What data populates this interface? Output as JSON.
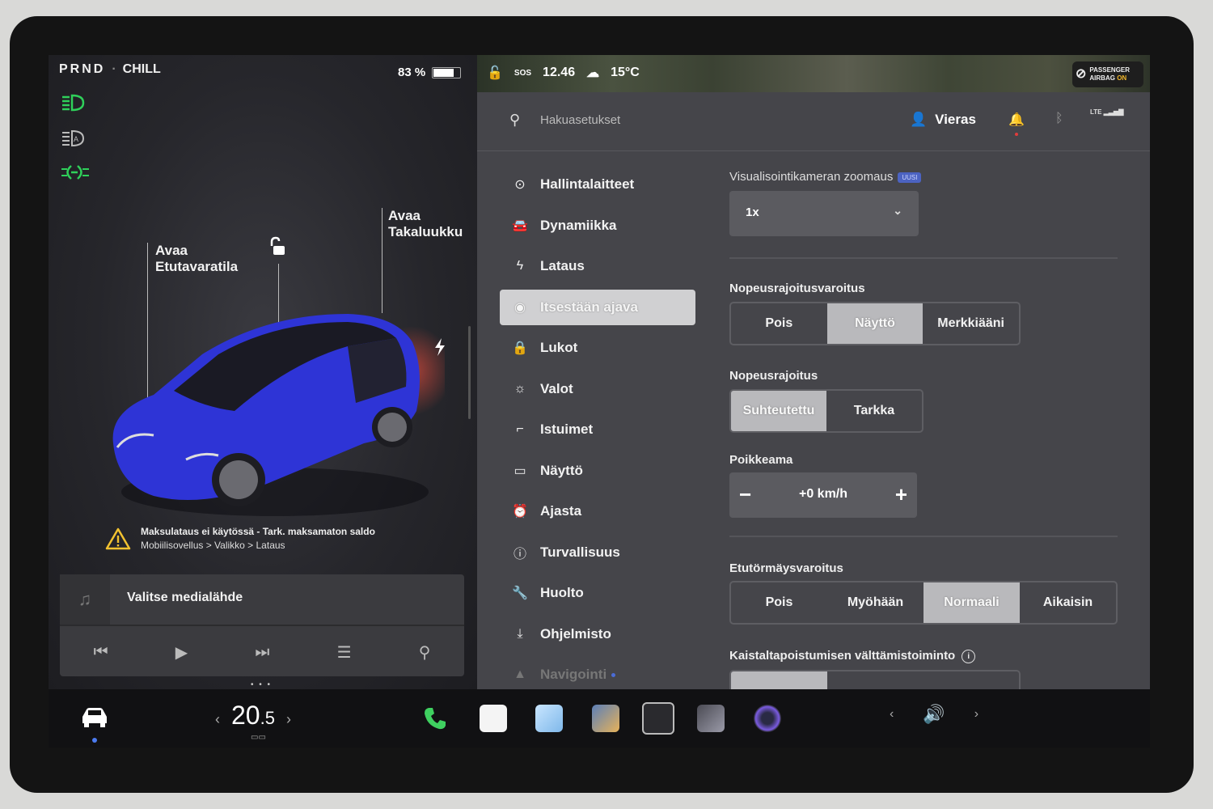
{
  "status": {
    "gears": "PRND",
    "separator": "·",
    "drive_mode": "CHILL",
    "battery_percent": "83 %",
    "battery_level": 0.83
  },
  "car_view": {
    "frunk_label_line1": "Avaa",
    "frunk_label_line2": "Etutavaratila",
    "trunk_label_line1": "Avaa",
    "trunk_label_line2": "Takaluukku",
    "car_color": "#2e34d6"
  },
  "warning": {
    "title": "Maksulataus ei käytössä - Tark. maksamaton saldo",
    "path": "Mobiilisovellus > Valikko > Lataus"
  },
  "media": {
    "source_label": "Valitse medialähde"
  },
  "top_status": {
    "sos": "SOS",
    "time": "12.46",
    "temperature": "15°C",
    "airbag_line1": "PASSENGER",
    "airbag_line2": "AIRBAG",
    "airbag_state": "ON",
    "lte": "LTE"
  },
  "search": {
    "placeholder": "Hakuasetukset"
  },
  "user": {
    "name": "Vieras"
  },
  "nav": {
    "items": [
      {
        "label": "Hallintalaitteet",
        "icon": "toggle-icon"
      },
      {
        "label": "Dynamiikka",
        "icon": "car-icon"
      },
      {
        "label": "Lataus",
        "icon": "bolt-icon"
      },
      {
        "label": "Itsestään ajava",
        "icon": "steering-wheel-icon"
      },
      {
        "label": "Lukot",
        "icon": "lock-icon"
      },
      {
        "label": "Valot",
        "icon": "sun-icon"
      },
      {
        "label": "Istuimet",
        "icon": "seat-icon"
      },
      {
        "label": "Näyttö",
        "icon": "display-icon"
      },
      {
        "label": "Ajasta",
        "icon": "alarm-clock-icon"
      },
      {
        "label": "Turvallisuus",
        "icon": "info-circle-icon"
      },
      {
        "label": "Huolto",
        "icon": "wrench-icon"
      },
      {
        "label": "Ohjelmisto",
        "icon": "download-icon"
      },
      {
        "label": "Navigointi",
        "icon": "navigation-icon"
      }
    ],
    "active_index": 3
  },
  "settings": {
    "camera_zoom_label": "Visualisointikameran zoomaus",
    "camera_zoom_badge": "UUSI",
    "camera_zoom_value": "1x",
    "speed_warning_label": "Nopeusrajoitusvaroitus",
    "speed_warning_options": [
      "Pois",
      "Näyttö",
      "Merkkiääni"
    ],
    "speed_warning_selected": 1,
    "speed_limit_label": "Nopeusrajoitus",
    "speed_limit_options": [
      "Suhteutettu",
      "Tarkka"
    ],
    "speed_limit_selected": 0,
    "offset_label": "Poikkeama",
    "offset_minus": "−",
    "offset_value": "+0 km/h",
    "offset_plus": "+",
    "collision_label": "Etutörmäysvaroitus",
    "collision_options": [
      "Pois",
      "Myöhään",
      "Normaali",
      "Aikaisin"
    ],
    "collision_selected": 2,
    "lane_label": "Kaistaltapoistumisen välttämistoiminto"
  },
  "taskbar": {
    "temp_whole": "20",
    "temp_frac": ".5",
    "left_arrow": "‹",
    "right_arrow": "›"
  }
}
